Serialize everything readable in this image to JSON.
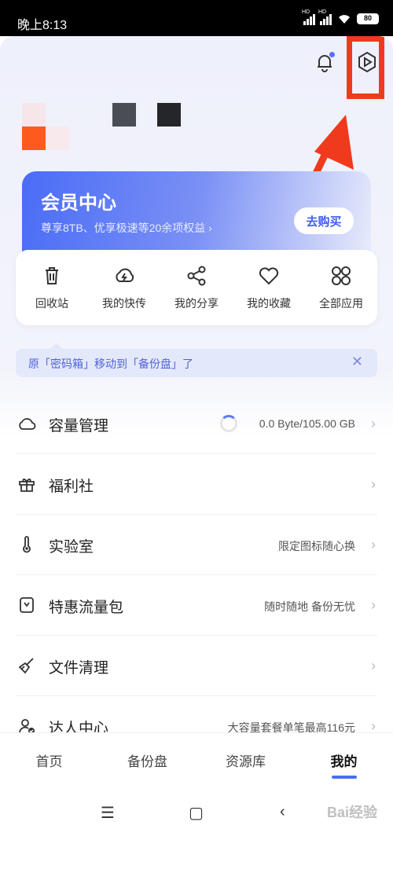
{
  "status_bar": {
    "time": "晚上8:13",
    "signal1": "HD",
    "signal2": "HD",
    "battery": "80"
  },
  "header": {
    "bell_icon": "bell-icon",
    "settings_icon": "settings-icon"
  },
  "vip": {
    "title": "会员中心",
    "subtitle": "尊享8TB、优享极速等20余项权益 ›",
    "buy_label": "去购买"
  },
  "quick_actions": [
    {
      "label": "回收站",
      "icon": "trash-icon"
    },
    {
      "label": "我的快传",
      "icon": "cloud-bolt-icon"
    },
    {
      "label": "我的分享",
      "icon": "share-icon"
    },
    {
      "label": "我的收藏",
      "icon": "heart-icon"
    },
    {
      "label": "全部应用",
      "icon": "apps-icon"
    }
  ],
  "notice": {
    "text": "原「密码箱」移动到「备份盘」了",
    "close": "✕"
  },
  "menu": [
    {
      "label": "容量管理",
      "right": "0.0 Byte/105.00 GB",
      "icon": "cloud-icon"
    },
    {
      "label": "福利社",
      "right": "",
      "icon": "gift-icon"
    },
    {
      "label": "实验室",
      "right": "限定图标随心换",
      "icon": "thermometer-icon"
    },
    {
      "label": "特惠流量包",
      "right": "随时随地 备份无忧",
      "icon": "sim-icon"
    },
    {
      "label": "文件清理",
      "right": "",
      "icon": "broom-icon"
    },
    {
      "label": "达人中心",
      "right": "大容量套餐单笔最高116元",
      "icon": "user-check-icon"
    }
  ],
  "tabs": [
    {
      "label": "首页"
    },
    {
      "label": "备份盘"
    },
    {
      "label": "资源库"
    },
    {
      "label": "我的"
    }
  ],
  "watermark": "Bai经验",
  "colors": {
    "accent": "#4a6cf6",
    "highlight": "#f03a1e"
  }
}
